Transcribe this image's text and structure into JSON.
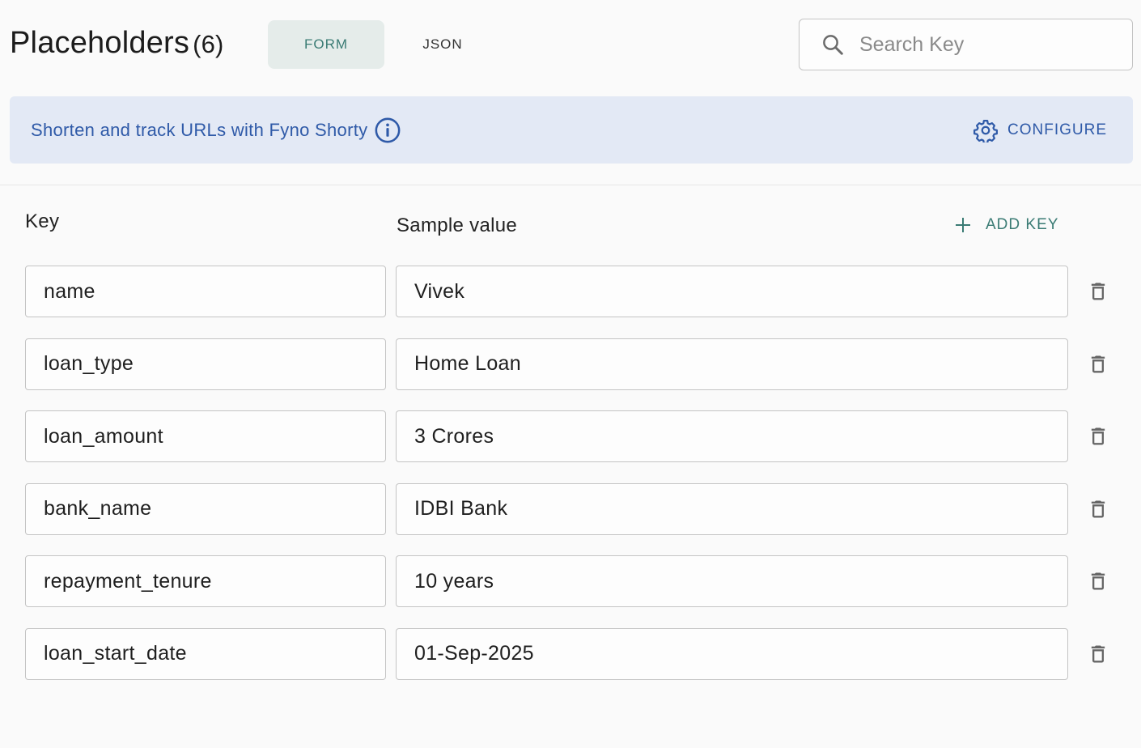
{
  "header": {
    "title": "Placeholders",
    "count": "(6)",
    "tabs": {
      "form": "FORM",
      "json": "JSON"
    },
    "search": {
      "placeholder": "Search Key"
    }
  },
  "banner": {
    "text": "Shorten and track URLs with Fyno Shorty",
    "configure_label": "CONFIGURE"
  },
  "columns": {
    "key": "Key",
    "value": "Sample value"
  },
  "add_key_label": "ADD KEY",
  "placeholders": [
    {
      "key": "name",
      "value": "Vivek"
    },
    {
      "key": "loan_type",
      "value": "Home Loan"
    },
    {
      "key": "loan_amount",
      "value": "3 Crores"
    },
    {
      "key": "bank_name",
      "value": "IDBI Bank"
    },
    {
      "key": "repayment_tenure",
      "value": "10 years"
    },
    {
      "key": "loan_start_date",
      "value": "01-Sep-2025"
    }
  ],
  "colors": {
    "accent_teal": "#3a7b74",
    "accent_blue": "#2f5aa8",
    "banner_bg": "#e3e9f5",
    "tab_active_bg": "#e5ecea"
  },
  "icons": {
    "search": "search-icon",
    "info": "info-icon",
    "configure": "gear-icon",
    "add": "plus-icon",
    "delete": "trash-icon"
  }
}
